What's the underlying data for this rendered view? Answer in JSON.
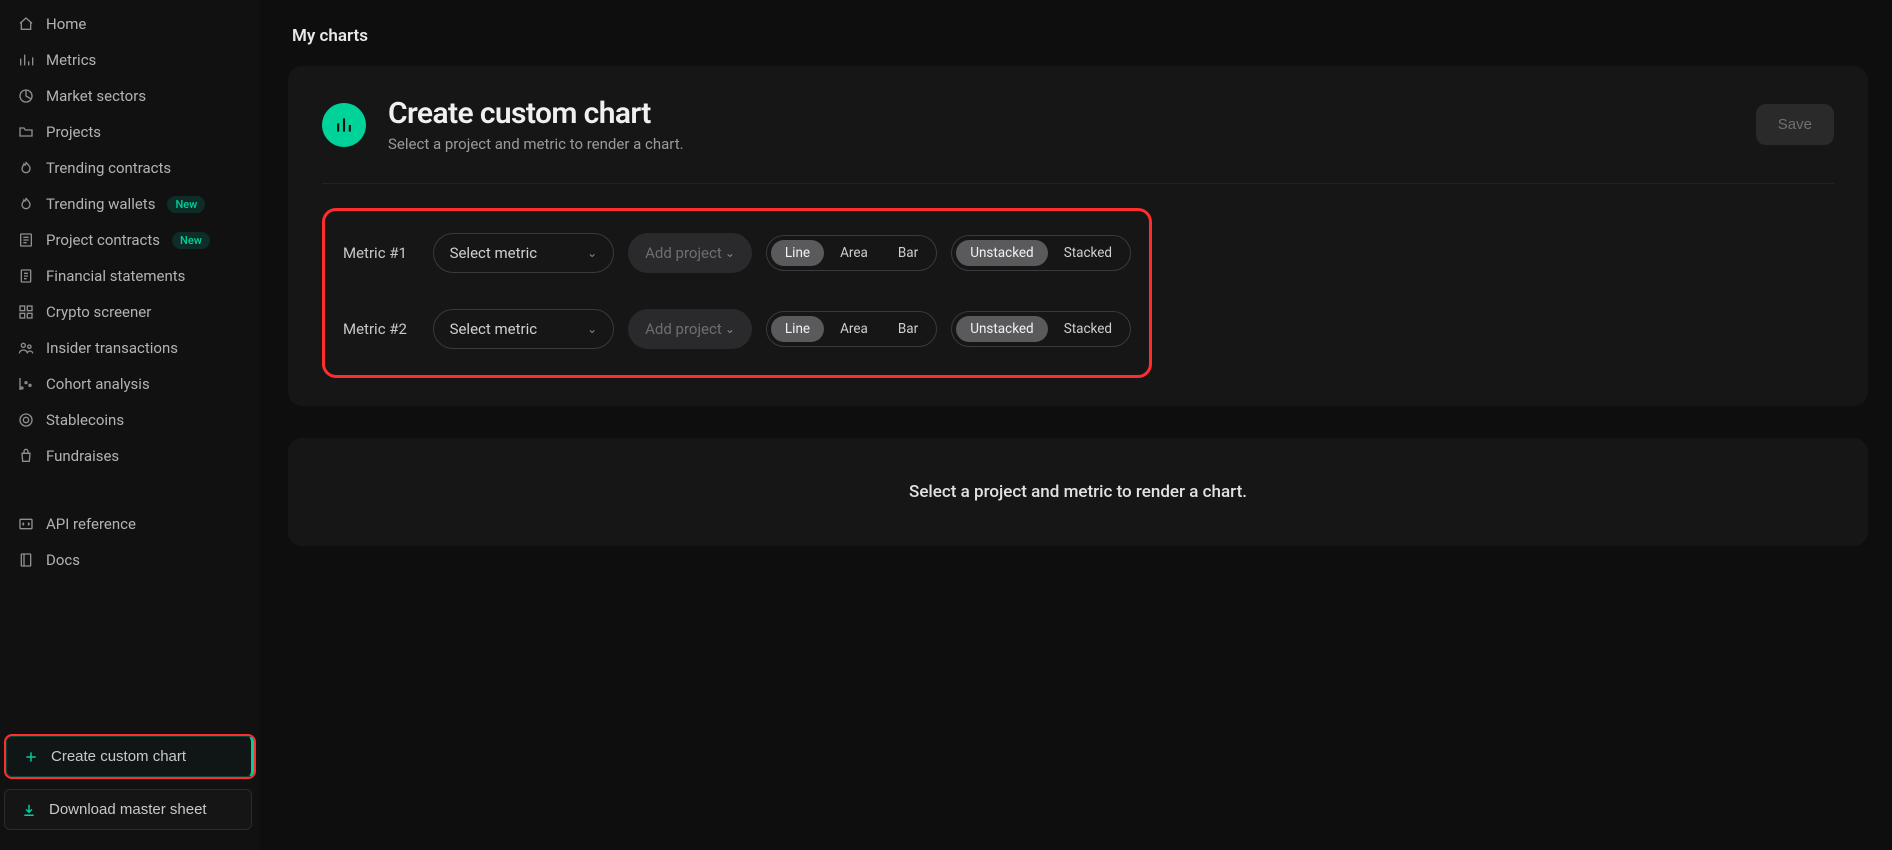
{
  "sidebar": {
    "items": [
      {
        "label": "Home",
        "icon": "home-icon"
      },
      {
        "label": "Metrics",
        "icon": "bars-icon"
      },
      {
        "label": "Market sectors",
        "icon": "pie-icon"
      },
      {
        "label": "Projects",
        "icon": "folder-icon"
      },
      {
        "label": "Trending contracts",
        "icon": "flame-icon"
      },
      {
        "label": "Trending wallets",
        "icon": "flame-icon",
        "badge": "New"
      },
      {
        "label": "Project contracts",
        "icon": "contract-icon",
        "badge": "New"
      },
      {
        "label": "Financial statements",
        "icon": "doc-icon"
      },
      {
        "label": "Crypto screener",
        "icon": "grid-icon"
      },
      {
        "label": "Insider transactions",
        "icon": "people-icon"
      },
      {
        "label": "Cohort analysis",
        "icon": "scatter-icon"
      },
      {
        "label": "Stablecoins",
        "icon": "coin-icon"
      },
      {
        "label": "Fundraises",
        "icon": "bag-icon"
      }
    ],
    "secondary": [
      {
        "label": "API reference",
        "icon": "code-icon"
      },
      {
        "label": "Docs",
        "icon": "book-icon"
      }
    ],
    "create_label": "Create custom chart",
    "download_label": "Download master sheet"
  },
  "page": {
    "heading": "My charts"
  },
  "card": {
    "title": "Create custom chart",
    "subtitle": "Select a project and metric to render a chart.",
    "save_label": "Save"
  },
  "metrics": [
    {
      "label": "Metric #1",
      "select_placeholder": "Select metric",
      "add_placeholder": "Add project",
      "type_options": [
        "Line",
        "Area",
        "Bar"
      ],
      "type_selected": "Line",
      "stack_options": [
        "Unstacked",
        "Stacked"
      ],
      "stack_selected": "Unstacked"
    },
    {
      "label": "Metric #2",
      "select_placeholder": "Select metric",
      "add_placeholder": "Add project",
      "type_options": [
        "Line",
        "Area",
        "Bar"
      ],
      "type_selected": "Line",
      "stack_options": [
        "Unstacked",
        "Stacked"
      ],
      "stack_selected": "Unstacked"
    }
  ],
  "placeholder": {
    "text": "Select a project and metric to render a chart."
  },
  "colors": {
    "accent": "#00d39a",
    "annotation": "#ff2d2d"
  }
}
